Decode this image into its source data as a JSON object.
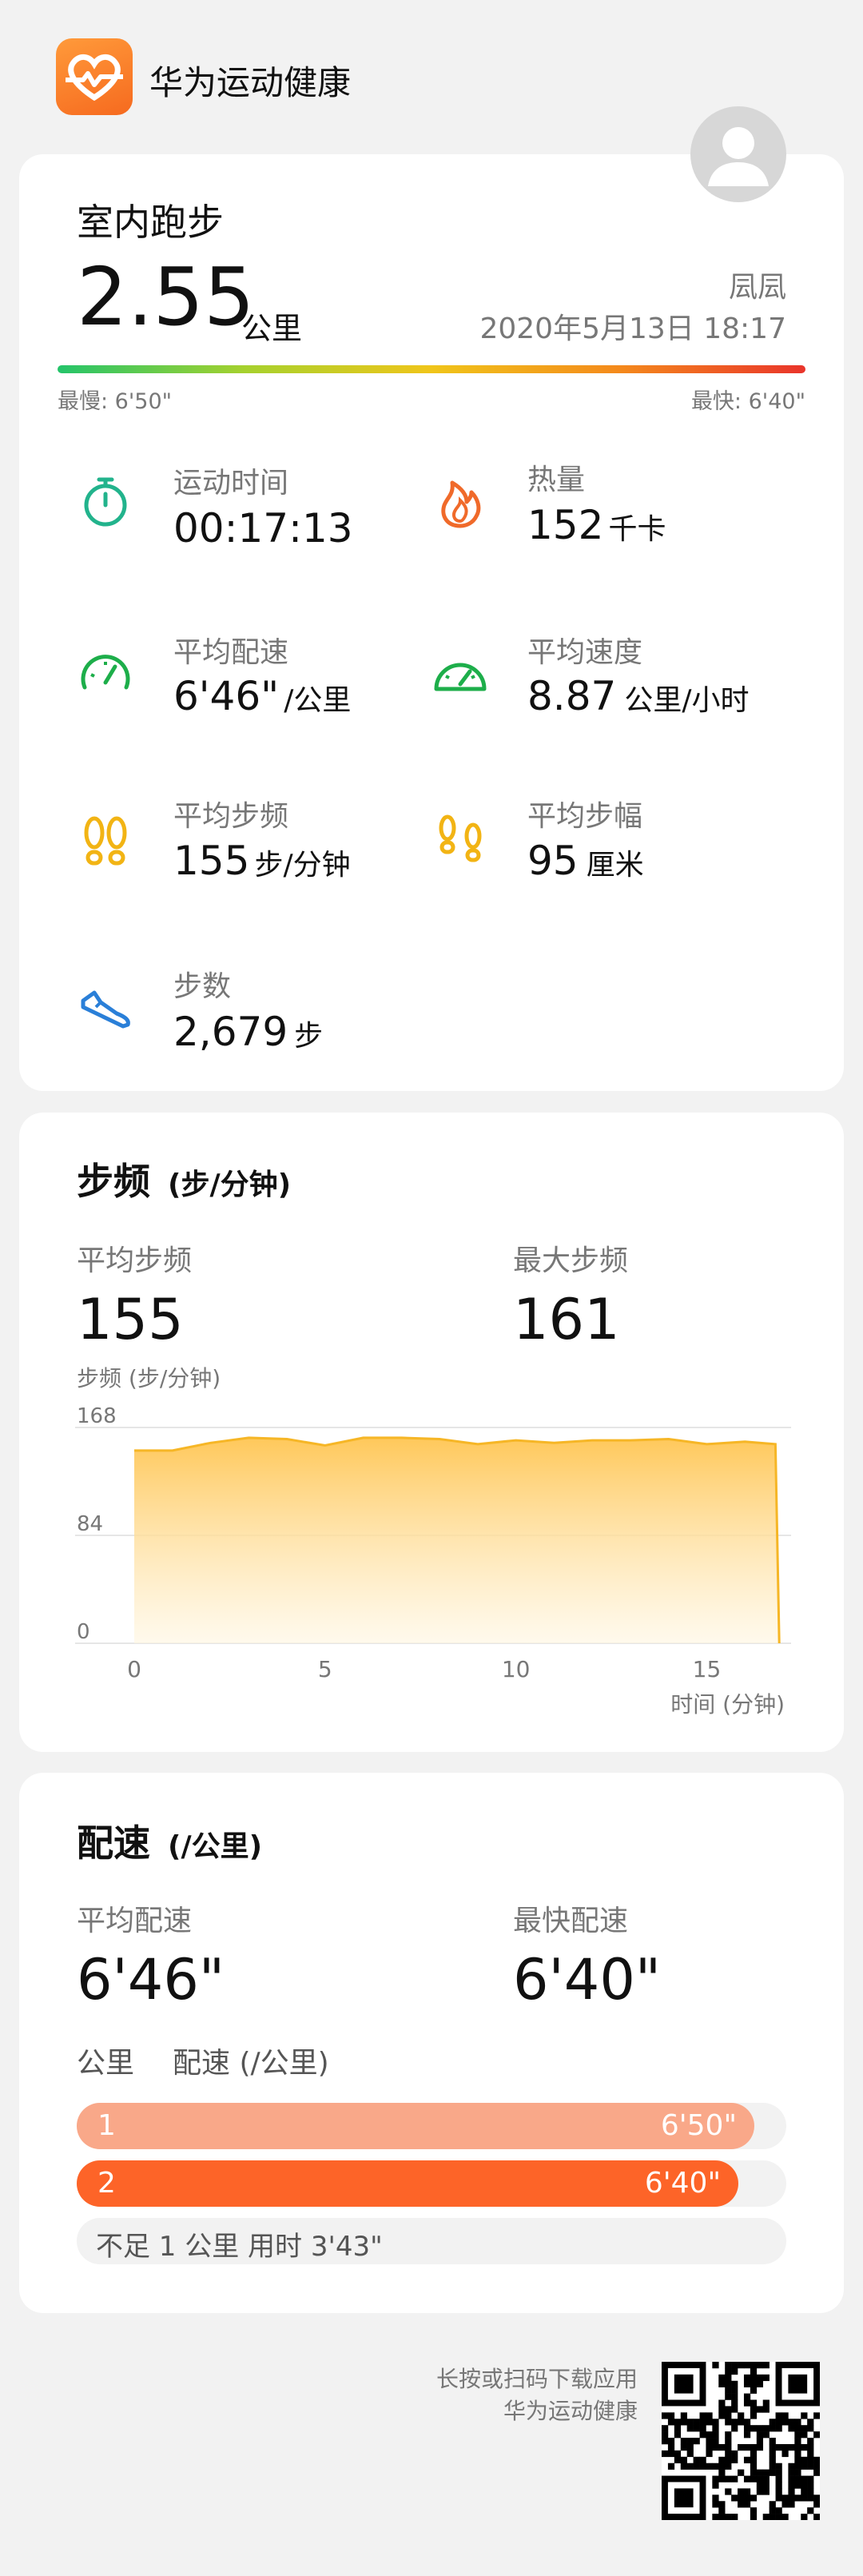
{
  "header": {
    "app_name": "华为运动健康"
  },
  "summary": {
    "title": "室内跑步",
    "distance": "2.55",
    "distance_unit": "公里",
    "user_name": "凨凨",
    "datetime": "2020年5月13日 18:17",
    "slowest_label": "最慢: 6'50\"",
    "fastest_label": "最快: 6'40\""
  },
  "metrics": [
    {
      "label": "运动时间",
      "value": "00:17:13",
      "unit": "",
      "icon": "stopwatch-icon",
      "color": "#22b38c"
    },
    {
      "label": "热量",
      "value": "152",
      "unit": "千卡",
      "icon": "flame-icon",
      "color": "#f06a2a"
    },
    {
      "label": "平均配速",
      "value": "6'46\"",
      "unit": "/公里",
      "icon": "speedometer-icon",
      "color": "#1dae4a"
    },
    {
      "label": "平均速度",
      "value": "8.87",
      "unit": "公里/小时",
      "icon": "speed-gauge-icon",
      "color": "#1dae4a"
    },
    {
      "label": "平均步频",
      "value": "155",
      "unit": "步/分钟",
      "icon": "footprints-icon",
      "color": "#f2b414"
    },
    {
      "label": "平均步幅",
      "value": "95",
      "unit": "厘米",
      "icon": "stride-icon",
      "color": "#f2b414"
    },
    {
      "label": "步数",
      "value": "2,679",
      "unit": "步",
      "icon": "shoe-icon",
      "color": "#2a7fd8"
    }
  ],
  "cadence": {
    "title": "步频",
    "title_unit": "(步/分钟)",
    "avg_label": "平均步频",
    "avg_value": "155",
    "max_label": "最大步频",
    "max_value": "161",
    "chart_label": "步频 (步/分钟)",
    "x_axis_label": "时间 (分钟)"
  },
  "chart_data": {
    "type": "area",
    "title": "",
    "ylabel": "步频 (步/分钟)",
    "xlabel": "时间 (分钟)",
    "x": [
      0,
      1,
      2,
      3,
      4,
      5,
      6,
      7,
      8,
      9,
      10,
      11,
      12,
      13,
      14,
      15,
      16,
      16.8,
      16.9
    ],
    "values": [
      150,
      150,
      156,
      160,
      159,
      154,
      160,
      160,
      159,
      155,
      158,
      156,
      158,
      158,
      159,
      155,
      157,
      155,
      0
    ],
    "x_ticks": [
      "0",
      "5",
      "10",
      "15"
    ],
    "x_tick_values": [
      0,
      5,
      10,
      15
    ],
    "y_ticks": [
      "168",
      "84",
      "0"
    ],
    "y_tick_values": [
      168,
      84,
      0
    ],
    "xlim": [
      0,
      17
    ],
    "ylim": [
      0,
      168
    ],
    "grid": true
  },
  "pace": {
    "title": "配速",
    "title_unit": "(/公里)",
    "avg_label": "平均配速",
    "avg_value": "6'46\"",
    "fast_label": "最快配速",
    "fast_value": "6'40\"",
    "col_km": "公里",
    "col_pace": "配速 (/公里)",
    "rows": [
      {
        "km": "1",
        "pace": "6'50\"",
        "fraction": 0.955,
        "color": "#f9a889"
      },
      {
        "km": "2",
        "pace": "6'40\"",
        "fraction": 0.932,
        "color": "#fd6428"
      }
    ],
    "remainder": "不足 1 公里 用时 3'43\""
  },
  "footer": {
    "line1": "长按或扫码下载应用",
    "line2": "华为运动健康"
  }
}
